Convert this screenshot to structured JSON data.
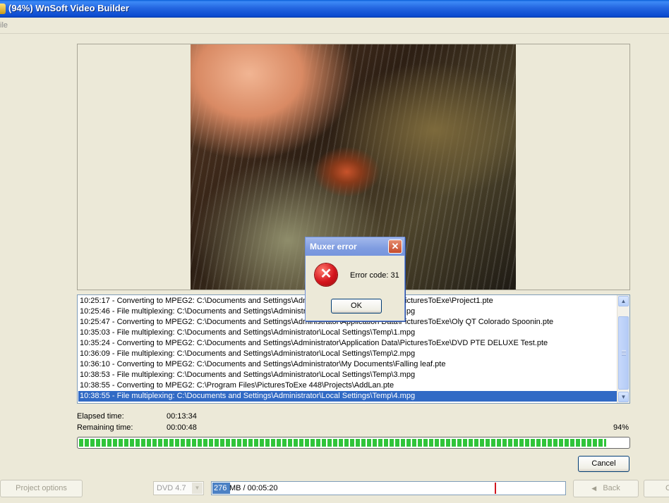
{
  "window": {
    "title": "(94%) WnSoft Video Builder"
  },
  "menu": {
    "items": [
      "File"
    ],
    "visible_text": "ile"
  },
  "log": {
    "rows": [
      "10:25:17 - Converting to MPEG2: C:\\Documents and Settings\\Administrator\\Application Data\\PicturesToExe\\Project1.pte",
      "10:25:46 - File multiplexing: C:\\Documents and Settings\\Administrator\\Local Settings\\Temp\\0.mpg",
      "10:25:47 - Converting to MPEG2: C:\\Documents and Settings\\Administrator\\Application Data\\PicturesToExe\\Oly QT Colorado Spoonin.pte",
      "10:35:03 - File multiplexing: C:\\Documents and Settings\\Administrator\\Local Settings\\Temp\\1.mpg",
      "10:35:24 - Converting to MPEG2: C:\\Documents and Settings\\Administrator\\Application Data\\PicturesToExe\\DVD PTE DELUXE Test.pte",
      "10:36:09 - File multiplexing: C:\\Documents and Settings\\Administrator\\Local Settings\\Temp\\2.mpg",
      "10:36:10 - Converting to MPEG2: C:\\Documents and Settings\\Administrator\\My Documents\\Falling leaf.pte",
      "10:38:53 - File multiplexing: C:\\Documents and Settings\\Administrator\\Local Settings\\Temp\\3.mpg",
      "10:38:55 - Converting to MPEG2: C:\\Program Files\\PicturesToExe 448\\Projects\\AddLan.pte",
      "10:38:55 - File multiplexing: C:\\Documents and Settings\\Administrator\\Local Settings\\Temp\\4.mpg"
    ],
    "selected_index": 9
  },
  "status": {
    "elapsed_label": "Elapsed time:",
    "elapsed_value": "00:13:34",
    "remaining_label": "Remaining time:",
    "remaining_value": "00:00:48",
    "percent_text": "94%",
    "progress_fraction": 0.96
  },
  "buttons": {
    "cancel": "Cancel",
    "project_options": "Project options",
    "back": "Back",
    "next_partial": "C"
  },
  "disc": {
    "type": "DVD 4.7",
    "used_mb": "276",
    "size_text": "MB / 00:05:20"
  },
  "dialog": {
    "title": "Muxer error",
    "message": "Error code: 31",
    "ok": "OK"
  },
  "colors": {
    "titlebar": "#2466e0",
    "selection": "#316ac5",
    "progress": "#30c43a",
    "error": "#d4141c"
  },
  "icons": {
    "dialog": "error-x-icon",
    "close": "close-icon",
    "back": "back-arrow-icon",
    "scroll_up": "scroll-up-icon",
    "scroll_down": "scroll-down-icon"
  }
}
